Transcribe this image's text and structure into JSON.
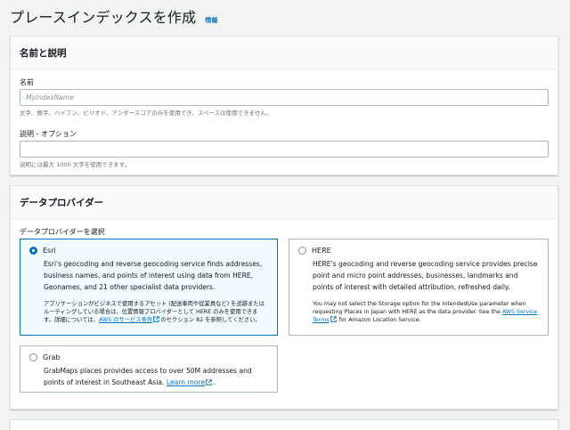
{
  "page": {
    "title": "プレースインデックスを作成",
    "info_link": "情報"
  },
  "name_section": {
    "header": "名前と説明",
    "name_label": "名前",
    "name_placeholder": "MyIndexName",
    "name_value": "",
    "name_hint": "文字、数字、ハイフン、ピリオド、アンダースコアのみを使用でき、スペースは使用できません。",
    "desc_label": "説明 - オプション",
    "desc_value": "",
    "desc_hint": "説明には最大 1000 文字を使用できます。"
  },
  "provider_section": {
    "header": "データプロバイダー",
    "group_label": "データプロバイダーを選択",
    "selected": "Esri",
    "esri": {
      "title": "Esri",
      "desc": "Esri's geocoding and reverse geocoding service finds addresses, business names, and points of interest using data from HERE, Geonames, and 21 other specialist data providers.",
      "note_before": "アプリケーションがビジネスで使用するアセット (配送車両や従業員など) を追跡またはルーティングしている場合は、位置情報プロバイダーとして HERE のみを使用できます。詳細については、",
      "note_link": "AWS のサービス条件",
      "note_after": "のセクション 82 を参照してください。"
    },
    "here": {
      "title": "HERE",
      "desc": "HERE's geocoding and reverse geocoding service provides precise point and micro point addresses, businesses, landmarks and points of interest with detailed attribution, refreshed daily.",
      "note_before": "You may not select the Storage option for the IntendedUse parameter when requesting Places in Japan with HERE as the data provider. See the ",
      "note_link": "AWS Service Terms",
      "note_after": " for Amazon Location Service."
    },
    "grab": {
      "title": "Grab",
      "desc_before": "GrabMaps places provides access to over 50M addresses and points of interest in Southeast Asia. ",
      "desc_link": "Learn more",
      "desc_after": "."
    }
  },
  "colors": {
    "accent": "#0073bb",
    "selected_bg": "#f1faff",
    "page_bg": "#f2f3f3"
  },
  "icons": {
    "external_link": "external-link-icon"
  }
}
